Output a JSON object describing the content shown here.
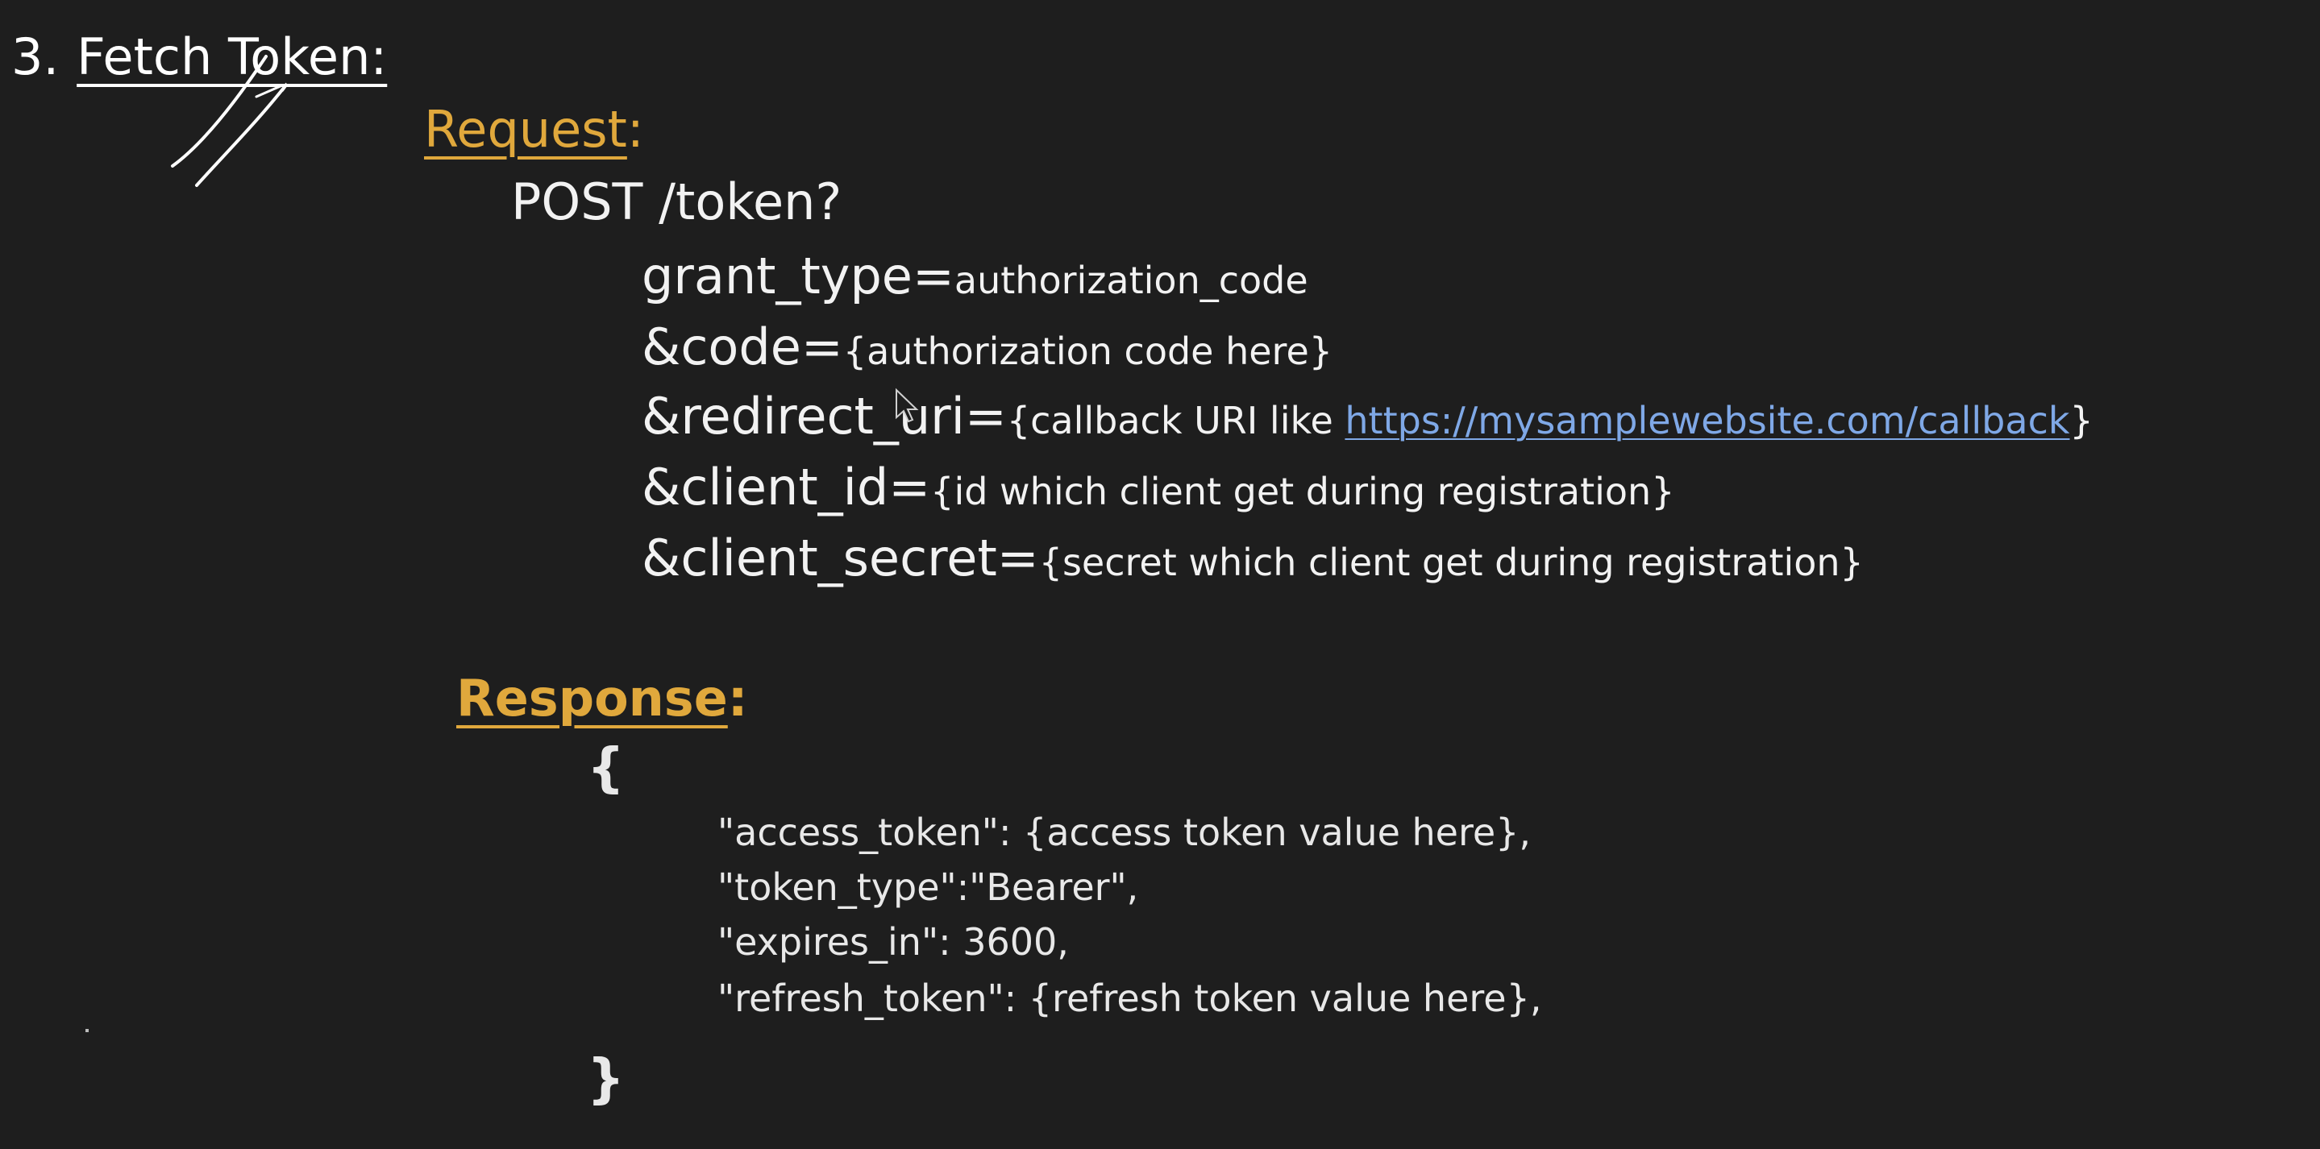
{
  "heading": {
    "number": "3.",
    "title": "Fetch Token:"
  },
  "request": {
    "label": "Request",
    "colon": ":",
    "method_line": "POST /token?",
    "params": [
      {
        "key": "grant_type=",
        "value": "authorization_code",
        "link": "",
        "suffix": ""
      },
      {
        "key": "&code=",
        "value": "{authorization code here}",
        "link": "",
        "suffix": ""
      },
      {
        "key": "&redirect_uri=",
        "value": "{callback URI like ",
        "link": "https://mysamplewebsite.com/callback",
        "suffix": "}"
      },
      {
        "key": "&client_id=",
        "value": "{id which client get during registration}",
        "link": "",
        "suffix": ""
      },
      {
        "key": "&client_secret=",
        "value": "{secret which client get during registration}",
        "link": "",
        "suffix": ""
      }
    ]
  },
  "response": {
    "label": "Response",
    "colon": ":",
    "open_brace": "{",
    "close_brace": "}",
    "lines": [
      "\"access_token\": {access token value here},",
      "\"token_type\":\"Bearer\",",
      "\"expires_in\": 3600,",
      "\"refresh_token\": {refresh token value here},"
    ]
  },
  "colors": {
    "background": "#1e1e1e",
    "section_label": "#e0a83c",
    "link": "#7fa8e6",
    "text": "#f2f2f2"
  }
}
